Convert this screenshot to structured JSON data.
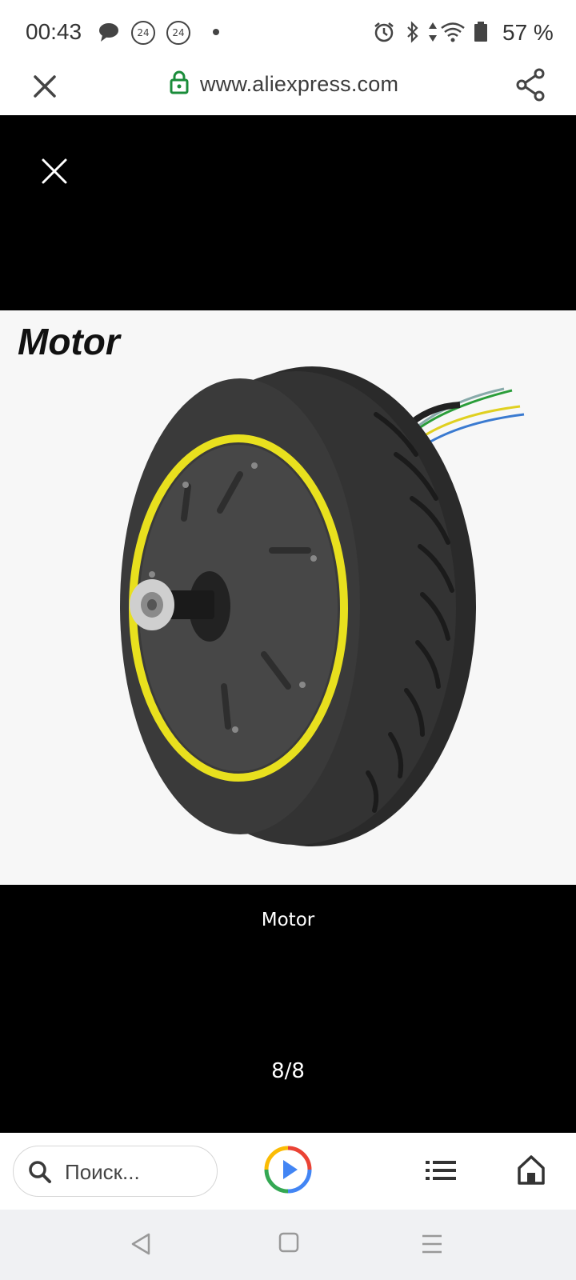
{
  "status_bar": {
    "time": "00:43",
    "badge_1": "24",
    "badge_2": "24",
    "battery": "57 %",
    "icons": [
      "chat-bubble-icon",
      "alarm-icon",
      "bluetooth-icon",
      "data-arrows-icon",
      "wifi-icon",
      "battery-icon"
    ]
  },
  "url_bar": {
    "url": "www.aliexpress.com",
    "icons": [
      "close-icon",
      "lock-icon",
      "share-icon"
    ],
    "lock_color": "#1a8c3a"
  },
  "viewer": {
    "image_title": "Motor",
    "caption": "Motor",
    "counter": "8/8",
    "icons": [
      "close-icon"
    ],
    "accent_yellow": "#e8e01e"
  },
  "toolbar": {
    "search_placeholder": "Поиск...",
    "icons": [
      "search-icon",
      "play-icon",
      "tabs-list-icon",
      "home-icon"
    ]
  },
  "nav_bar": {
    "icons": [
      "back-icon",
      "home-square-icon",
      "recent-apps-icon"
    ]
  }
}
